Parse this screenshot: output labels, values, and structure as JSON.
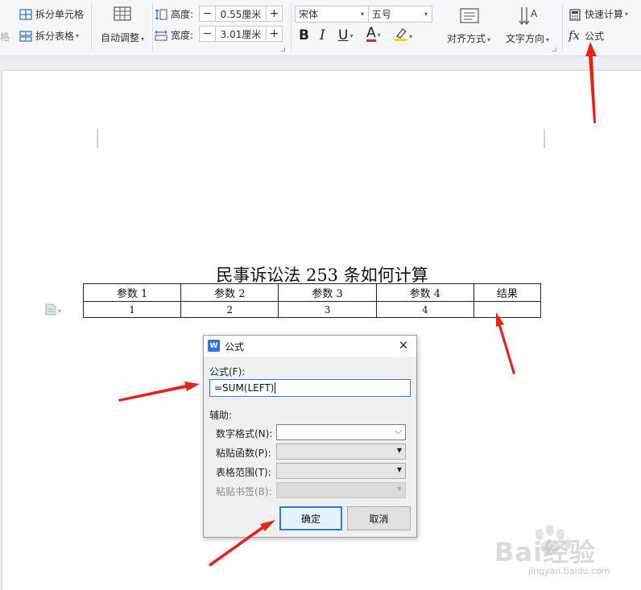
{
  "ribbon": {
    "cut_fragment": "格",
    "split_cell": "拆分单元格",
    "split_table": "拆分表格",
    "auto_fit": "自动调整",
    "height_label": "高度:",
    "height_value": "0.55厘米",
    "width_label": "宽度:",
    "width_value": "3.01厘米",
    "minus": "−",
    "plus": "+",
    "font_name": "宋体",
    "font_size": "五号",
    "bold": "B",
    "italic": "I",
    "underline": "U",
    "font_color_letter": "A",
    "align": "对齐方式",
    "text_direction": "文字方向",
    "quick_calc": "快速计算",
    "formula_fx": "fx",
    "formula": "公式"
  },
  "document": {
    "title": "民事诉讼法 253 条如何计算",
    "table": {
      "headers": [
        "参数 1",
        "参数 2",
        "参数 3",
        "参数 4",
        "结果"
      ],
      "rows": [
        [
          "1",
          "2",
          "3",
          "4",
          ""
        ]
      ]
    }
  },
  "dialog": {
    "logo": "W",
    "title": "公式",
    "close": "✕",
    "formula_label": "公式(F):",
    "formula_value": "=SUM(LEFT)",
    "helper_label": "辅助:",
    "number_format_label": "数字格式(N):",
    "paste_function_label": "粘贴函数(P):",
    "table_range_label": "表格范围(T):",
    "paste_bookmark_label": "粘贴书签(B):",
    "ok": "确定",
    "cancel": "取消"
  },
  "watermark": {
    "brand": "Bai经验",
    "url": "jingyan.baidu.com"
  },
  "colors": {
    "accent_blue": "#2d7bd3",
    "arrow_red": "#e8231b",
    "ribbon_bg": "#f5f6f7"
  }
}
